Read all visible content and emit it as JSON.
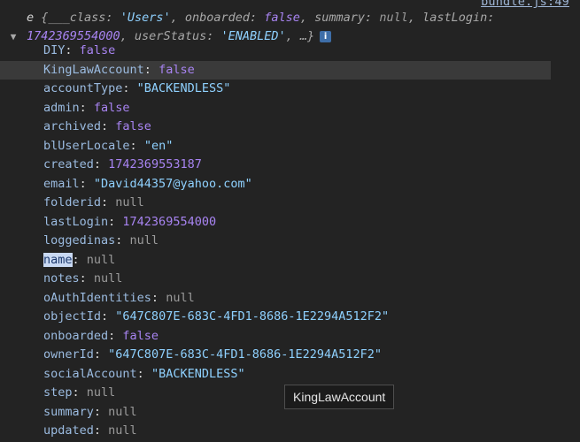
{
  "source_link": "bundle.js:49",
  "summary": {
    "toggle_glyph": "▼",
    "object_name": "e",
    "line1": "{___class: 'Users', onboarded: false, summary: null, lastLogin:",
    "line2": "1742369554000, userStatus: 'ENABLED', …}",
    "info_badge": "i"
  },
  "properties": [
    {
      "key": "DIY",
      "value": "false",
      "type": "bool"
    },
    {
      "key": "KingLawAccount",
      "value": "false",
      "type": "bool"
    },
    {
      "key": "accountType",
      "value": "\"BACKENDLESS\"",
      "type": "str"
    },
    {
      "key": "admin",
      "value": "false",
      "type": "bool"
    },
    {
      "key": "archived",
      "value": "false",
      "type": "bool"
    },
    {
      "key": "blUserLocale",
      "value": "\"en\"",
      "type": "str"
    },
    {
      "key": "created",
      "value": "1742369553187",
      "type": "num"
    },
    {
      "key": "email",
      "value": "\"David44357@yahoo.com\"",
      "type": "str"
    },
    {
      "key": "folderid",
      "value": "null",
      "type": "null"
    },
    {
      "key": "lastLogin",
      "value": "1742369554000",
      "type": "num"
    },
    {
      "key": "loggedinas",
      "value": "null",
      "type": "null"
    },
    {
      "key": "name",
      "value": "null",
      "type": "null"
    },
    {
      "key": "notes",
      "value": "null",
      "type": "null"
    },
    {
      "key": "oAuthIdentities",
      "value": "null",
      "type": "null"
    },
    {
      "key": "objectId",
      "value": "\"647C807E-683C-4FD1-8686-1E2294A512F2\"",
      "type": "str"
    },
    {
      "key": "onboarded",
      "value": "false",
      "type": "bool"
    },
    {
      "key": "ownerId",
      "value": "\"647C807E-683C-4FD1-8686-1E2294A512F2\"",
      "type": "str"
    },
    {
      "key": "socialAccount",
      "value": "\"BACKENDLESS\"",
      "type": "str"
    },
    {
      "key": "step",
      "value": "null",
      "type": "null"
    },
    {
      "key": "summary",
      "value": "null",
      "type": "null"
    },
    {
      "key": "updated",
      "value": "null",
      "type": "null"
    }
  ],
  "hovered_key": "KingLawAccount",
  "selected_key": "name",
  "tooltip": "KingLawAccount",
  "colors": {
    "background": "#232323",
    "key": "#9bbbe0",
    "string": "#8fd1ff",
    "boolean_number": "#a884f2",
    "null": "#9b9b9b",
    "selection": "#c9d9f3"
  }
}
